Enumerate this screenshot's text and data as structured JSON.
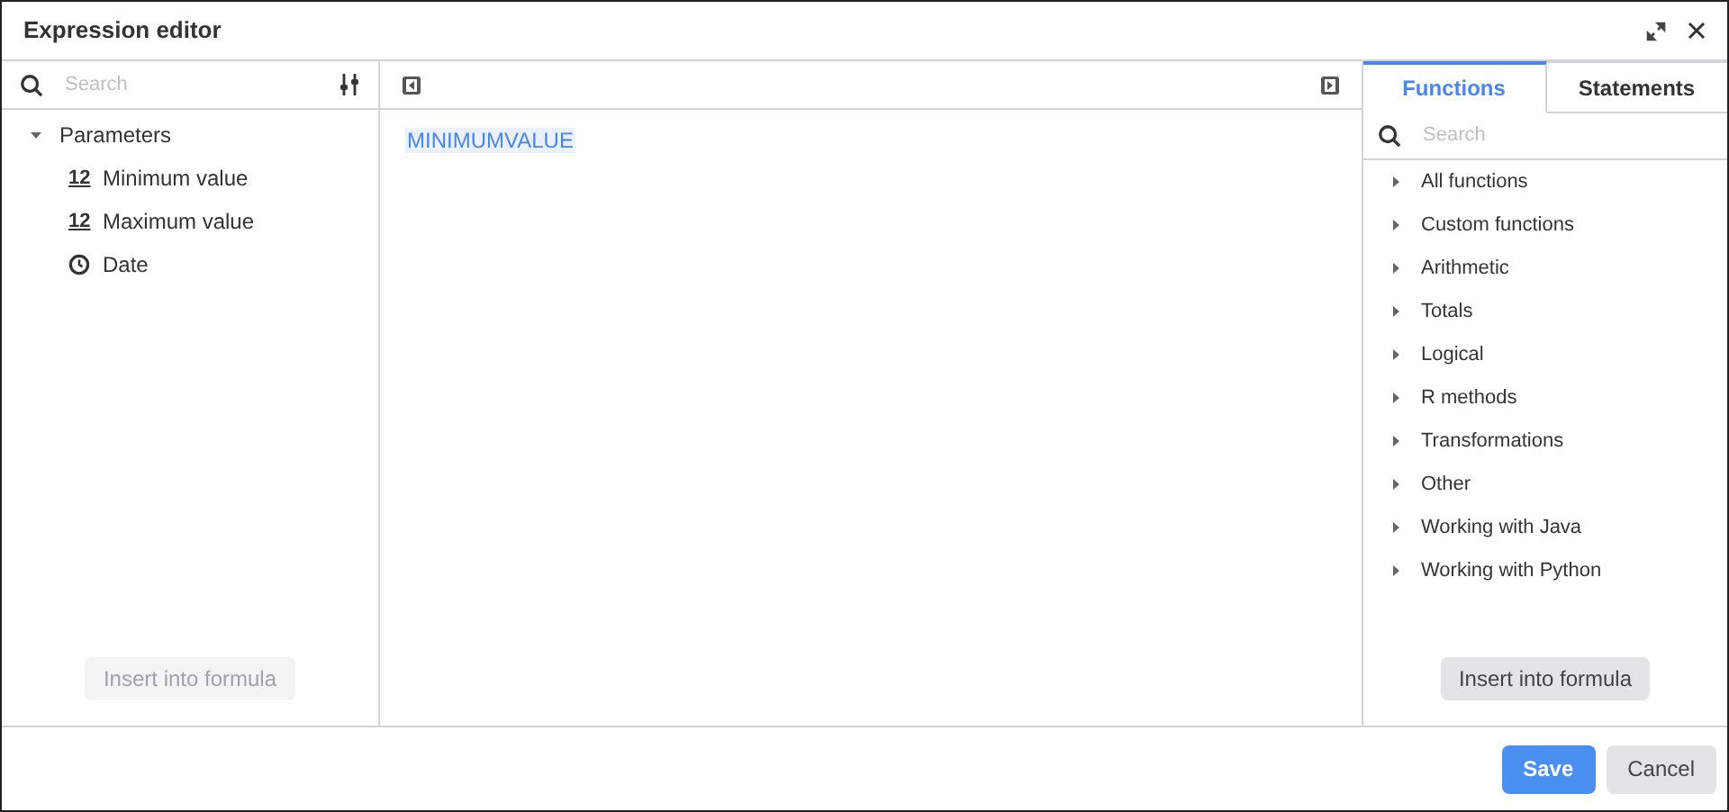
{
  "window": {
    "title": "Expression editor"
  },
  "left_panel": {
    "search": {
      "placeholder": "Search"
    },
    "tree": [
      {
        "label": "Parameters",
        "expanded": true,
        "children": [
          {
            "label": "Minimum value",
            "kind": "number",
            "icon_text": "12"
          },
          {
            "label": "Maximum value",
            "kind": "number",
            "icon_text": "12"
          },
          {
            "label": "Date",
            "kind": "date"
          }
        ]
      }
    ],
    "insert_button": {
      "label": "Insert into formula",
      "disabled": true
    }
  },
  "editor": {
    "formula": "MINIMUMVALUE"
  },
  "right_panel": {
    "tabs": [
      {
        "label": "Functions",
        "selected": true
      },
      {
        "label": "Statements",
        "selected": false
      }
    ],
    "search": {
      "placeholder": "Search"
    },
    "categories": [
      {
        "label": "All functions",
        "expanded": false
      },
      {
        "label": "Custom functions",
        "expanded": false
      },
      {
        "label": "Arithmetic",
        "expanded": false
      },
      {
        "label": "Totals",
        "expanded": false
      },
      {
        "label": "Logical",
        "expanded": false
      },
      {
        "label": "R methods",
        "expanded": false
      },
      {
        "label": "Transformations",
        "expanded": false
      },
      {
        "label": "Other",
        "expanded": false
      },
      {
        "label": "Working with Java",
        "expanded": false
      },
      {
        "label": "Working with Python",
        "expanded": false
      }
    ],
    "insert_button": {
      "label": "Insert into formula",
      "disabled": false
    }
  },
  "footer": {
    "buttons": [
      {
        "label": "Save",
        "kind": "primary"
      },
      {
        "label": "Cancel",
        "kind": "secondary"
      }
    ]
  }
}
